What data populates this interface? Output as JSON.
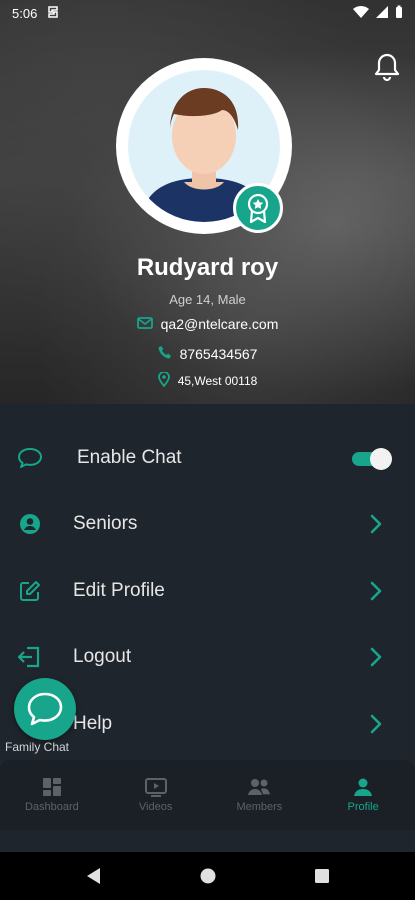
{
  "status_bar": {
    "time": "5:06"
  },
  "colors": {
    "accent": "#17a58c",
    "background": "#1f252c",
    "nav_inactive": "#5b6269"
  },
  "profile": {
    "name": "Rudyard roy",
    "age_gender": "Age 14, Male",
    "email": "qa2@ntelcare.com",
    "phone": "8765434567",
    "address": "45,West 00118"
  },
  "menu": {
    "items": [
      {
        "label": "Enable Chat",
        "icon": "chat-bubble-icon",
        "control": "toggle",
        "toggle_on": true
      },
      {
        "label": "Seniors",
        "icon": "person-icon",
        "control": "chevron"
      },
      {
        "label": "Edit Profile",
        "icon": "edit-icon",
        "control": "chevron"
      },
      {
        "label": "Logout",
        "icon": "logout-icon",
        "control": "chevron"
      },
      {
        "label": "Help",
        "icon": "help-icon",
        "control": "chevron"
      }
    ]
  },
  "fab": {
    "label": "Family Chat",
    "icon": "chat-bubble-icon"
  },
  "bottom_nav": {
    "items": [
      {
        "label": "Dashboard",
        "icon": "dashboard-icon"
      },
      {
        "label": "Videos",
        "icon": "video-icon"
      },
      {
        "label": "Members",
        "icon": "members-icon"
      },
      {
        "label": "Profile",
        "icon": "profile-icon",
        "active": true
      }
    ]
  }
}
